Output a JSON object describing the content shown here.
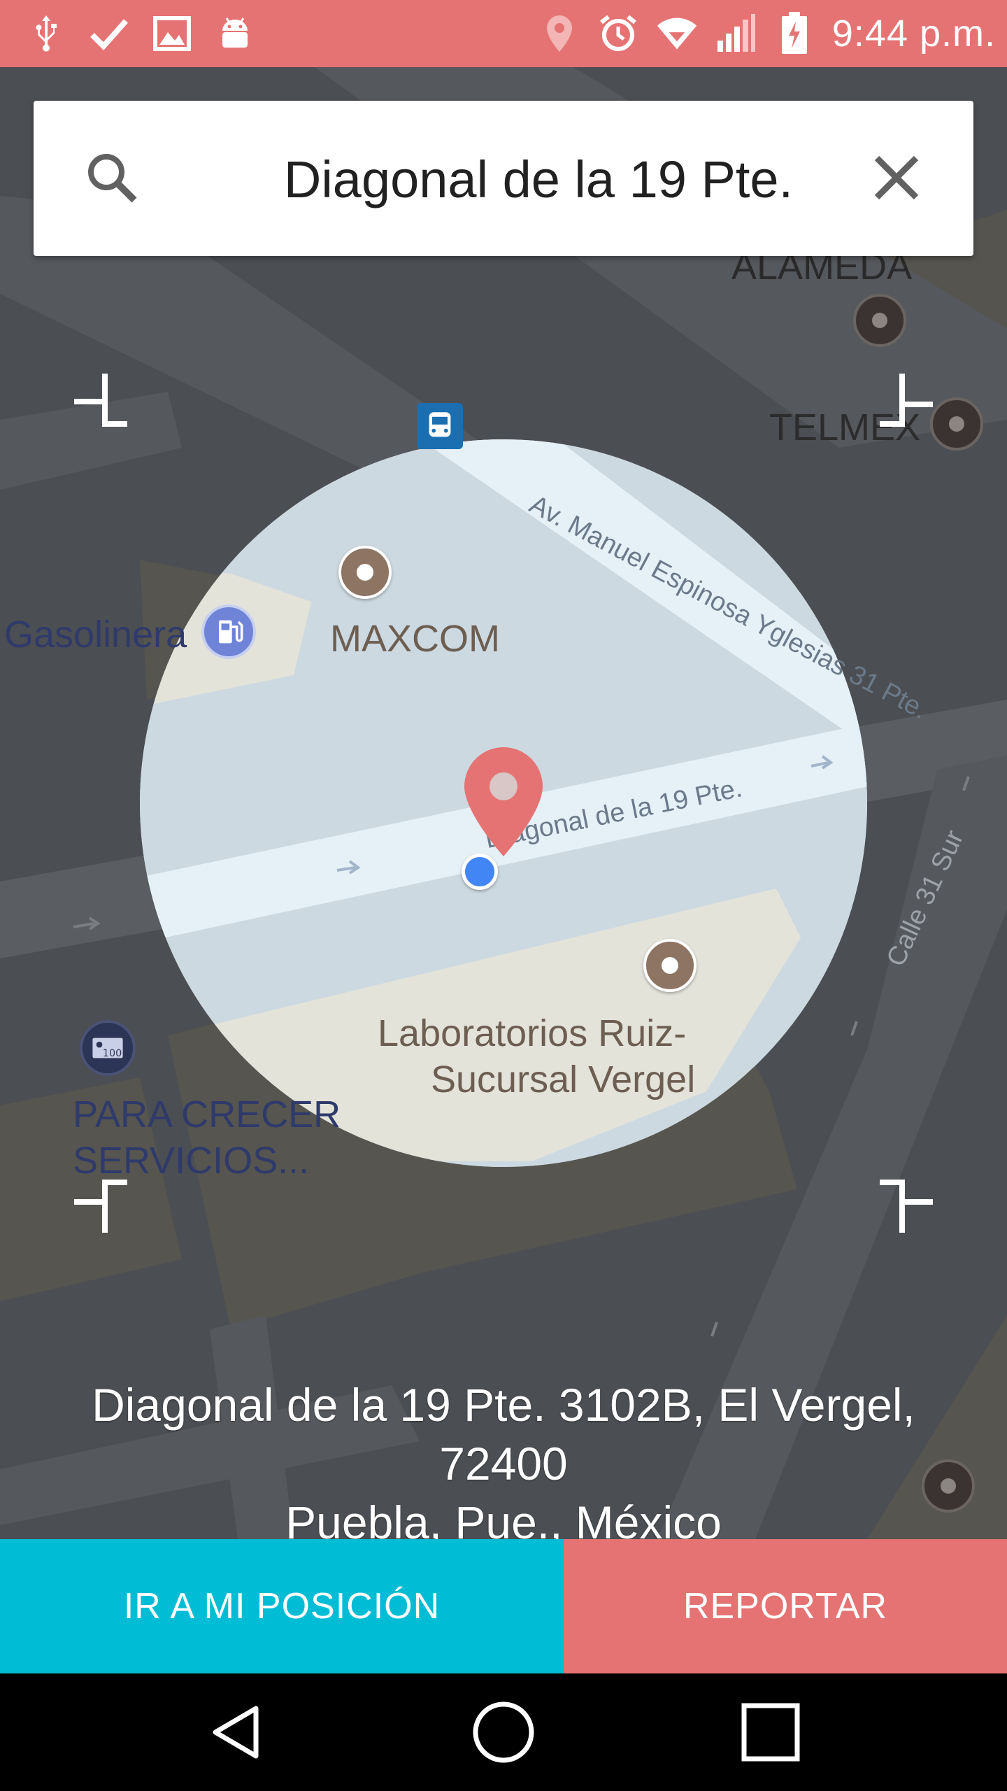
{
  "status_bar": {
    "time": "9:44 p.m.",
    "left_icons": [
      "usb-icon",
      "check-icon",
      "image-icon",
      "android-icon"
    ],
    "right_icons": [
      "location-icon",
      "alarm-icon",
      "wifi-icon",
      "signal-icon",
      "battery-charging-icon"
    ]
  },
  "search": {
    "value": "Diagonal de la 19 Pte."
  },
  "map": {
    "labels": {
      "alameda": "ALAMEDA",
      "telmex": "TELMEX",
      "gasolinera": "Gasolinera",
      "maxcom": "MAXCOM",
      "av_manuel": "Av. Manuel Espinosa Yglesias 31 Pte.",
      "diagonal": "Diagonal de la 19 Pte.",
      "calle_31": "Calle 31 Sur",
      "laboratorios_1": "Laboratorios Ruiz-",
      "laboratorios_2": "Sucursal Vergel",
      "para_crecer_1": "PARA CRECER",
      "para_crecer_2": "SERVICIOS..."
    },
    "colors": {
      "pin": "#e57373",
      "location_dot": "#4285f4"
    }
  },
  "address": {
    "line1": "Diagonal de la 19 Pte. 3102B, El Vergel, 72400",
    "line2": "Puebla, Pue., México"
  },
  "actions": {
    "go_to_position": "IR A MI POSICIÓN",
    "report": "REPORTAR"
  },
  "nav": {
    "icons": [
      "back-icon",
      "home-icon",
      "recents-icon"
    ]
  }
}
